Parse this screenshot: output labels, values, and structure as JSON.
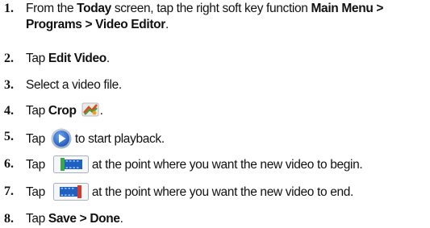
{
  "steps": [
    {
      "num": "1.",
      "parts": [
        {
          "t": "From the "
        },
        {
          "t": "Today",
          "b": true
        },
        {
          "t": " screen, tap the right soft key function "
        },
        {
          "t": "Main Menu > Programs > Video Editor",
          "b": true
        },
        {
          "t": "."
        }
      ]
    },
    {
      "num": "2.",
      "parts": [
        {
          "t": "Tap "
        },
        {
          "t": "Edit Video",
          "b": true
        },
        {
          "t": "."
        }
      ]
    },
    {
      "num": "3.",
      "parts": [
        {
          "t": "Select a video file."
        }
      ]
    },
    {
      "num": "4.",
      "parts": [
        {
          "t": "Tap "
        },
        {
          "t": "Crop",
          "b": true
        },
        {
          "t": " "
        },
        {
          "icon": "crop-icon"
        },
        {
          "t": "."
        }
      ]
    },
    {
      "num": "5.",
      "parts": [
        {
          "t": "Tap "
        },
        {
          "icon": "play-icon"
        },
        {
          "t": "to start playback."
        }
      ]
    },
    {
      "num": "6.",
      "parts": [
        {
          "t": "Tap "
        },
        {
          "icon": "mark-start-icon"
        },
        {
          "t": "at the point where you want the new video to begin."
        }
      ]
    },
    {
      "num": "7.",
      "parts": [
        {
          "t": "Tap "
        },
        {
          "icon": "mark-end-icon"
        },
        {
          "t": "at the point where you want the new video to end."
        }
      ]
    },
    {
      "num": "8.",
      "parts": [
        {
          "t": "Tap "
        },
        {
          "t": "Save > Done",
          "b": true
        },
        {
          "t": "."
        }
      ]
    }
  ],
  "colors": {
    "text": "#111111",
    "play_blue": "#2b6fd6",
    "start_marker_green": "#3aa84a",
    "end_marker_red": "#d23a2a",
    "filmstrip_blue": "#1e5fbf"
  }
}
